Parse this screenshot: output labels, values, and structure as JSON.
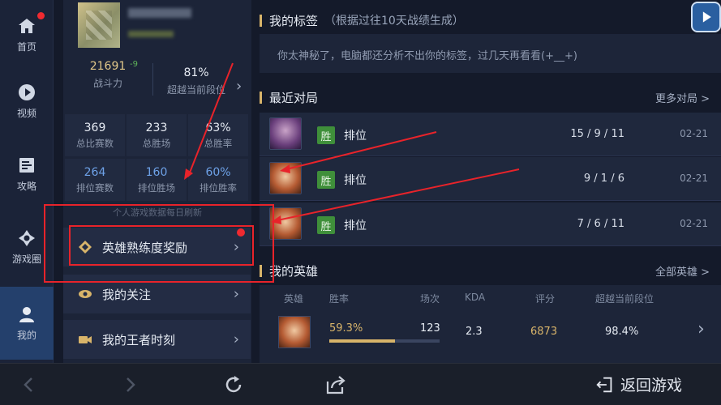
{
  "nav": {
    "items": [
      {
        "label": "首页",
        "icon": "home-icon"
      },
      {
        "label": "视频",
        "icon": "play-icon"
      },
      {
        "label": "攻略",
        "icon": "guide-icon"
      },
      {
        "label": "游戏圈",
        "icon": "circle-icon"
      },
      {
        "label": "我的",
        "icon": "user-icon"
      }
    ]
  },
  "profile": {
    "combat_power": "21691",
    "combat_delta": "-9",
    "combat_label": "战斗力",
    "rank_pct": "81%",
    "rank_label": "超越当前段位",
    "stats": [
      {
        "value": "369",
        "label": "总比赛数"
      },
      {
        "value": "233",
        "label": "总胜场"
      },
      {
        "value": "63%",
        "label": "总胜率"
      },
      {
        "value": "264",
        "label": "排位赛数"
      },
      {
        "value": "160",
        "label": "排位胜场"
      },
      {
        "value": "60%",
        "label": "排位胜率"
      }
    ],
    "refresh_note": "个人游戏数据每日刷新"
  },
  "menu": {
    "hero_reward": "英雄熟练度奖励",
    "follow": "我的关注",
    "moments": "我的王者时刻"
  },
  "tags": {
    "title": "我的标签",
    "subtitle": "（根据过往10天战绩生成）",
    "message": "你太神秘了，电脑都还分析不出你的标签，过几天再看看(+__+)"
  },
  "recent": {
    "title": "最近对局",
    "more": "更多对局 >",
    "matches": [
      {
        "result": "胜",
        "mode": "排位",
        "kda": "15 / 9 / 11",
        "date": "02-21"
      },
      {
        "result": "胜",
        "mode": "排位",
        "kda": "9 / 1 / 6",
        "date": "02-21"
      },
      {
        "result": "胜",
        "mode": "排位",
        "kda": "7 / 6 / 11",
        "date": "02-21"
      }
    ]
  },
  "heroes": {
    "title": "我的英雄",
    "more": "全部英雄 >",
    "columns": [
      "英雄",
      "胜率",
      "场次",
      "KDA",
      "评分",
      "超越当前段位"
    ],
    "rows": [
      {
        "winrate": "59.3%",
        "winrate_fraction": 0.593,
        "games": "123",
        "kda": "2.3",
        "score": "6873",
        "rank": "98.4%"
      }
    ]
  },
  "bottom": {
    "return_label": "返回游戏"
  },
  "colors": {
    "accent_gold": "#d8b46a",
    "win_green": "#3f8f3a",
    "annotation_red": "#e8232a",
    "blue_stat": "#6ea2e8"
  }
}
